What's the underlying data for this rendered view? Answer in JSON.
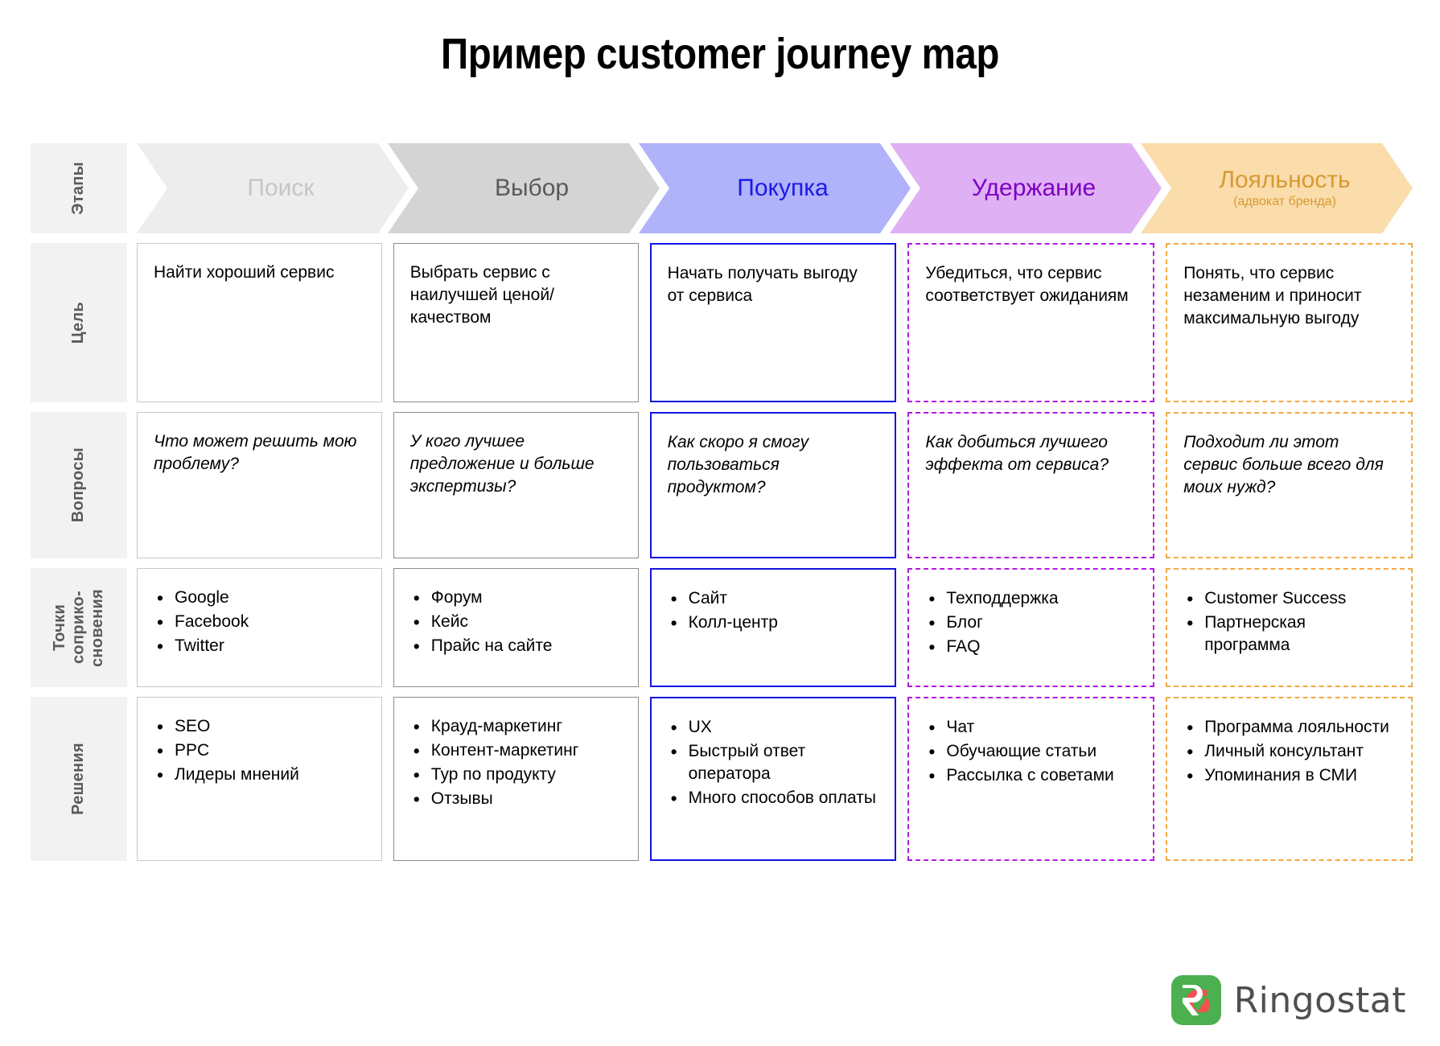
{
  "page": {
    "title": "Пример customer journey map"
  },
  "colors": {
    "stage_search_bg": "#ededed",
    "stage_search_text": "#c6c6c6",
    "stage_choice_bg": "#d4d4d4",
    "stage_choice_text": "#595959",
    "stage_purchase_bg": "#b0b2fa",
    "stage_purchase_text": "#1a1ae6",
    "stage_retention_bg": "#e0b0f5",
    "stage_retention_text": "#7d00c4",
    "stage_loyalty_bg": "#fbdcab",
    "stage_loyalty_text": "#d89a33",
    "border_search": "#c8c8c8",
    "border_choice": "#8c8c8c",
    "border_purchase": "#1414e0",
    "border_retention": "#b21ae0",
    "border_loyalty": "#f5a742",
    "label_bg": "#f2f2f2",
    "label_text": "#5a5a5a",
    "logo_green": "#4caf50",
    "logo_red": "#ef5350",
    "logo_text": "#4f4f4f"
  },
  "stages_header": {
    "row_label": "Этапы",
    "stages": [
      {
        "label": "Поиск",
        "sub": ""
      },
      {
        "label": "Выбор",
        "sub": ""
      },
      {
        "label": "Покупка",
        "sub": ""
      },
      {
        "label": "Удержание",
        "sub": ""
      },
      {
        "label": "Лояльность",
        "sub": "(адвокат бренда)"
      }
    ]
  },
  "rows": [
    {
      "label": "Цель",
      "style": "plain",
      "cells": [
        {
          "text": "Найти хороший сервис"
        },
        {
          "text": "Выбрать сервис с наилучшей ценой/качеством"
        },
        {
          "text": "Начать получать выгоду от сервиса"
        },
        {
          "text": "Убедиться, что сервис соответствует ожиданиям"
        },
        {
          "text": "Понять, что сервис незаменим и приносит максимальную выгоду"
        }
      ]
    },
    {
      "label": "Вопросы",
      "style": "italic",
      "cells": [
        {
          "text": "Что может решить мою проблему?"
        },
        {
          "text": "У кого лучшее предложение и больше экспертизы?"
        },
        {
          "text": "Как скоро я смогу пользоваться продуктом?"
        },
        {
          "text": "Как добиться лучшего эффекта от сервиса?"
        },
        {
          "text": "Подходит ли этот сервис больше всего для моих нужд?"
        }
      ]
    },
    {
      "label": "Точки соприко-\nсновения",
      "style": "list",
      "cells": [
        {
          "items": [
            "Google",
            "Facebook",
            "Twitter"
          ]
        },
        {
          "items": [
            "Форум",
            "Кейс",
            "Прайс на сайте"
          ]
        },
        {
          "items": [
            "Сайт",
            "Колл-центр"
          ]
        },
        {
          "items": [
            "Техподдержка",
            "Блог",
            "FAQ"
          ]
        },
        {
          "items": [
            "Customer Success",
            "Партнерская программа"
          ]
        }
      ]
    },
    {
      "label": "Решения",
      "style": "list",
      "cells": [
        {
          "items": [
            "SEO",
            "PPC",
            "Лидеры мнений"
          ]
        },
        {
          "items": [
            "Крауд-маркетинг",
            "Контент-маркетинг",
            "Тур по продукту",
            "Отзывы"
          ]
        },
        {
          "items": [
            "UX",
            "Быстрый ответ оператора",
            "Много способов оплаты"
          ]
        },
        {
          "items": [
            "Чат",
            "Обучающие статьи",
            "Рассылка с советами"
          ]
        },
        {
          "items": [
            "Программа лояльности",
            "Личный консультант",
            "Упоминания в СМИ"
          ]
        }
      ]
    }
  ],
  "logo": {
    "name": "Ringostat",
    "mark": "ringostat-logo-icon"
  }
}
